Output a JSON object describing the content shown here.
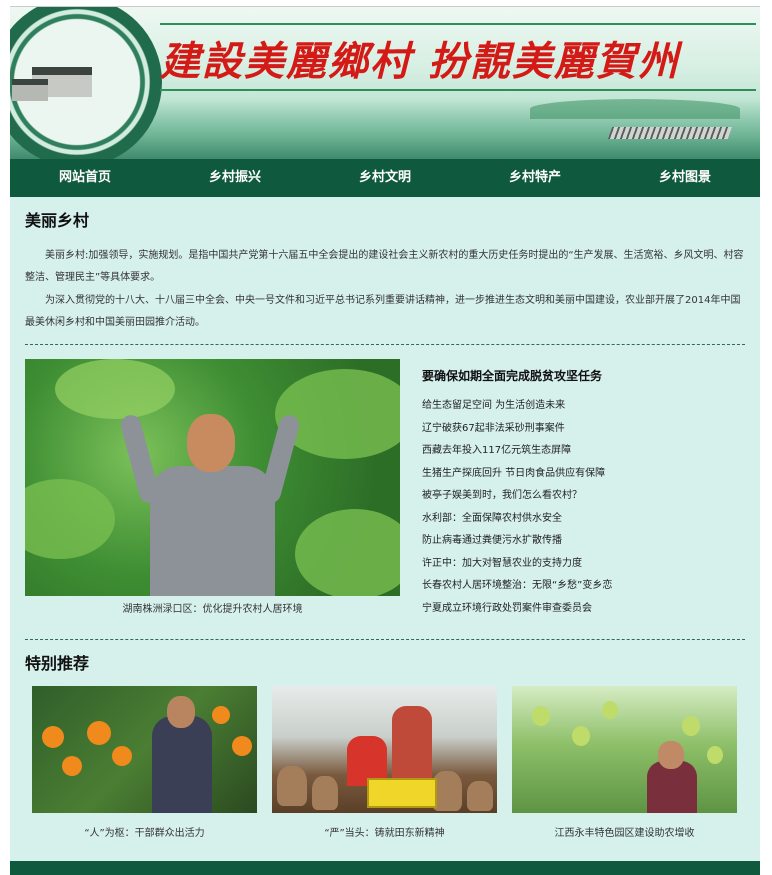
{
  "banner": {
    "slogan": "建設美麗鄉村 扮靚美麗賀州"
  },
  "nav": {
    "items": [
      "网站首页",
      "乡村振兴",
      "乡村文明",
      "乡村特产",
      "乡村图景"
    ]
  },
  "intro": {
    "title": "美丽乡村",
    "paragraphs": [
      "美丽乡村:加强领导，实施规划。是指中国共产党第十六届五中全会提出的建设社会主义新农村的重大历史任务时提出的“生产发展、生活宽裕、乡风文明、村容整洁、管理民主”等具体要求。",
      "为深入贯彻党的十八大、十八届三中全会、中央一号文件和习近平总书记系列重要讲话精神，进一步推进生态文明和美丽中国建设，农业部开展了2014年中国最美休闲乡村和中国美丽田园推介活动。"
    ]
  },
  "news": {
    "photo_caption": "湖南株洲渌口区：优化提升农村人居环境",
    "title": "要确保如期全面完成脱贫攻坚任务",
    "items": [
      "给生态留足空间 为生活创造未来",
      "辽宁破获67起非法采砂刑事案件",
      "西藏去年投入117亿元筑生态屏障",
      "生猪生产探底回升 节日肉食品供应有保障",
      "被亭子娱美到时，我们怎么看农村？",
      "水利部：全面保障农村供水安全",
      "防止病毒通过粪便污水扩散传播",
      "许正中：加大对智慧农业的支持力度",
      "长春农村人居环境整治：无限“乡愁”变乡恋",
      "宁夏成立环境行政处罚案件审查委员会"
    ]
  },
  "feature": {
    "title": "特别推荐",
    "cards": [
      {
        "caption": "“人”为枢：干部群众出活力"
      },
      {
        "caption": "“严”当头：铸就田东新精神"
      },
      {
        "caption": "江西永丰特色园区建设助农增收"
      }
    ]
  }
}
